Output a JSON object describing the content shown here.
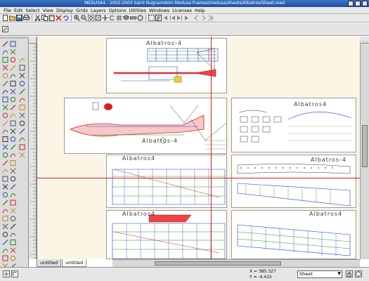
{
  "window": {
    "title": "MEDUSA4 - 2002-2003 Saint Nugnamdorn Medusa Frames/medusa/sheets/Albatros/Sheet.med"
  },
  "menu": {
    "items": [
      "File",
      "Edit",
      "Select",
      "View",
      "Display",
      "Grids",
      "Layers",
      "Options",
      "Utilities",
      "Windows",
      "Licenses",
      "Help"
    ]
  },
  "drawing": {
    "sheet_titles": [
      "Albatros-4",
      "Albatros-4",
      "Albatros4",
      "Albatros4",
      "Albatros-4",
      "Albatros4",
      "Albatros4"
    ]
  },
  "tabs": [
    {
      "label": "untitled"
    },
    {
      "label": "untitled"
    }
  ],
  "status": {
    "x_readout": "X = 385.327",
    "y_readout": "Y = -4.415",
    "sheet_value": "Sheet"
  },
  "colors": {
    "accent_title": "#2b63b4",
    "drawing_bg": "#fbf5e6",
    "model_red": "#d62020",
    "model_green": "#1a9a1a",
    "model_blue": "#1f3fd6"
  }
}
